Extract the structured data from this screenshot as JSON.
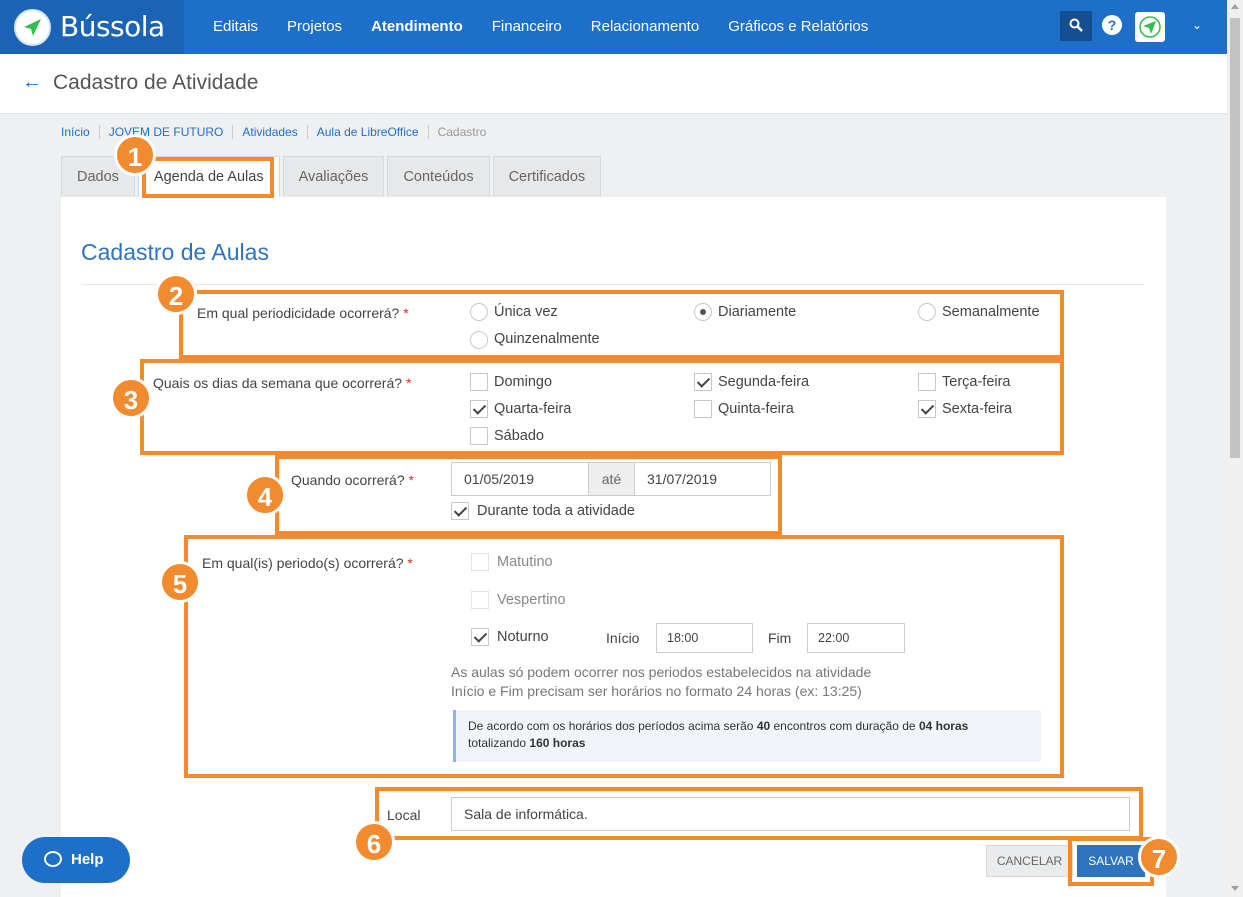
{
  "app": {
    "name": "Bússola"
  },
  "nav": [
    "Editais",
    "Projetos",
    "Atendimento",
    "Financeiro",
    "Relacionamento",
    "Gráficos e Relatórios"
  ],
  "nav_active": "Atendimento",
  "header": {
    "help_symbol": "?",
    "title": "Cadastro de Atividade"
  },
  "breadcrumb": [
    "Início",
    "JOVEM DE FUTURO",
    "Atividades",
    "Aula de LibreOffice",
    "Cadastro"
  ],
  "tabs": [
    "Dados",
    "Agenda de Aulas",
    "Avaliações",
    "Conteúdos",
    "Certificados"
  ],
  "active_tab": "Agenda de Aulas",
  "form": {
    "section_title": "Cadastro de Aulas",
    "periodicity": {
      "label": "Em qual periodicidade ocorrerá?",
      "required_mark": "*",
      "options": [
        "Única vez",
        "Diariamente",
        "Semanalmente",
        "Quinzenalmente"
      ],
      "selected": "Diariamente"
    },
    "weekdays": {
      "label": "Quais os dias da semana que ocorrerá?",
      "required_mark": "*",
      "options": [
        "Domingo",
        "Segunda-feira",
        "Terça-feira",
        "Quarta-feira",
        "Quinta-feira",
        "Sexta-feira",
        "Sábado"
      ],
      "checked": [
        false,
        true,
        false,
        true,
        false,
        true,
        false
      ]
    },
    "when": {
      "label": "Quando ocorrerá?",
      "required_mark": "*",
      "start": "01/05/2019",
      "separator": "até",
      "end": "31/07/2019",
      "whole_activity_label": "Durante toda a atividade",
      "whole_activity_checked": true
    },
    "periods": {
      "label": "Em qual(is) periodo(s) ocorrerá?",
      "required_mark": "*",
      "morning": "Matutino",
      "afternoon": "Vespertino",
      "night": "Noturno",
      "night_checked": true,
      "start_label": "Início",
      "start_value": "18:00",
      "end_label": "Fim",
      "end_value": "22:00",
      "hint1": "As aulas só podem ocorrer nos periodos estabelecidos na atividade",
      "hint2": "Início e Fim precisam ser horários no formato 24 horas (ex: 13:25)",
      "info_pre": "De acordo com os horários dos períodos acima serão ",
      "info_count": "40",
      "info_mid": " encontros com duração de ",
      "info_duration": "04 horas",
      "info_line2_pre": "totalizando ",
      "info_total": "160 horas"
    },
    "local": {
      "label": "Local",
      "value": "Sala de informática."
    }
  },
  "buttons": {
    "cancel": "CANCELAR",
    "save": "SALVAR",
    "help": "Help"
  },
  "annotations": [
    "1",
    "2",
    "3",
    "4",
    "5",
    "6",
    "7"
  ],
  "colors": {
    "topbar": "#1e6fc9",
    "annotation": "#f28a2f",
    "accent": "#2e74bd",
    "required": "#d0312d"
  }
}
